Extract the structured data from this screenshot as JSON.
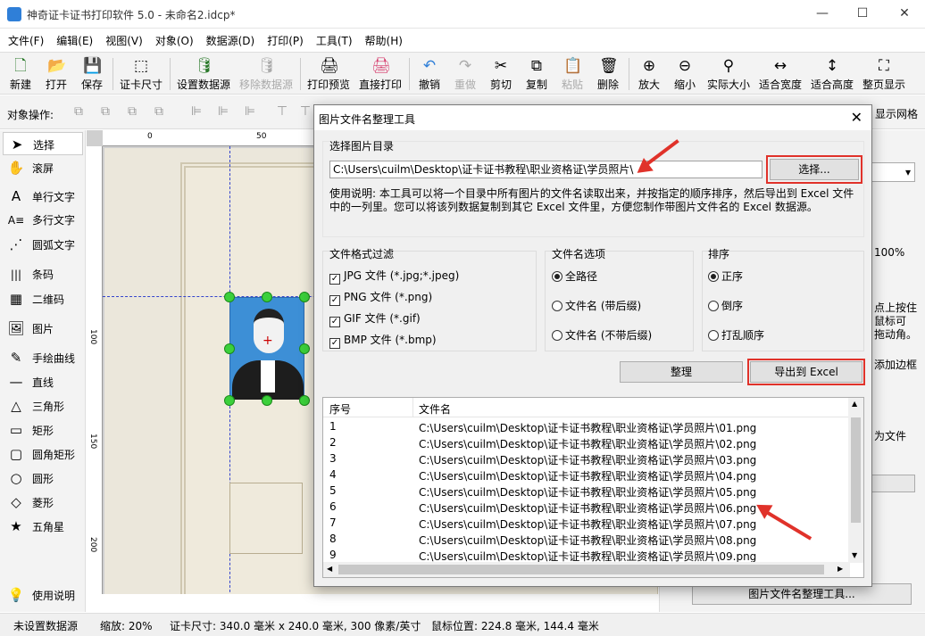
{
  "window": {
    "title": "神奇证卡证书打印软件 5.0 - 未命名2.idcp*",
    "min": "—",
    "max": "☐",
    "close": "✕"
  },
  "menu": [
    "文件(F)",
    "编辑(E)",
    "视图(V)",
    "对象(O)",
    "数据源(D)",
    "打印(P)",
    "工具(T)",
    "帮助(H)"
  ],
  "toolbar": [
    {
      "label": "新建",
      "icon": "🗋"
    },
    {
      "label": "打开",
      "icon": "📂"
    },
    {
      "label": "保存",
      "icon": "💾"
    },
    {
      "label": "证卡尺寸",
      "icon": "⬚"
    },
    {
      "label": "设置数据源",
      "icon": "🛢"
    },
    {
      "label": "移除数据源",
      "icon": "🛢"
    },
    {
      "label": "打印预览",
      "icon": "🖨"
    },
    {
      "label": "直接打印",
      "icon": "🖨"
    },
    {
      "label": "撤销",
      "icon": "↶"
    },
    {
      "label": "重做",
      "icon": "↷"
    },
    {
      "label": "剪切",
      "icon": "✂"
    },
    {
      "label": "复制",
      "icon": "⧉"
    },
    {
      "label": "粘贴",
      "icon": "📋"
    },
    {
      "label": "删除",
      "icon": "🗑"
    },
    {
      "label": "放大",
      "icon": "⊕"
    },
    {
      "label": "缩小",
      "icon": "⊖"
    },
    {
      "label": "实际大小",
      "icon": "⚲"
    },
    {
      "label": "适合宽度",
      "icon": "↔"
    },
    {
      "label": "适合高度",
      "icon": "↕"
    },
    {
      "label": "整页显示",
      "icon": "⛶"
    }
  ],
  "objbar": {
    "label": "对象操作:",
    "grid": "显示网格"
  },
  "tools": [
    {
      "label": "选择",
      "icon": "➤"
    },
    {
      "label": "滚屏",
      "icon": "✋"
    },
    {
      "label": "单行文字",
      "icon": "A"
    },
    {
      "label": "多行文字",
      "icon": "A≡"
    },
    {
      "label": "圆弧文字",
      "icon": "⋰"
    },
    {
      "label": "条码",
      "icon": "|||"
    },
    {
      "label": "二维码",
      "icon": "▦"
    },
    {
      "label": "图片",
      "icon": "🖼"
    },
    {
      "label": "手绘曲线",
      "icon": "✎"
    },
    {
      "label": "直线",
      "icon": "—"
    },
    {
      "label": "三角形",
      "icon": "△"
    },
    {
      "label": "矩形",
      "icon": "▭"
    },
    {
      "label": "圆角矩形",
      "icon": "▢"
    },
    {
      "label": "圆形",
      "icon": "○"
    },
    {
      "label": "菱形",
      "icon": "◇"
    },
    {
      "label": "五角星",
      "icon": "★"
    },
    {
      "label": "使用说明",
      "icon": "💡"
    }
  ],
  "ruler": {
    "top": [
      "0",
      "50"
    ],
    "left": [
      "100",
      "150",
      "200"
    ]
  },
  "rightpanel": {
    "pct": "100%",
    "t1": "点上按住",
    "t2": "鼠标可",
    "t3": "拖动角。",
    "t4": "添加边框",
    "t5": "为文件",
    "button": "图片文件名整理工具..."
  },
  "status": {
    "ds": "未设置数据源",
    "zoom": "缩放: 20%",
    "size": "证卡尺寸: 340.0 毫米 x 240.0 毫米, 300 像素/英寸",
    "mouse": "鼠标位置: 224.8 毫米, 144.4 毫米"
  },
  "dialog": {
    "title": "图片文件名整理工具",
    "close": "✕",
    "dir_label": "选择图片目录",
    "dir_value": "C:\\Users\\cuilm\\Desktop\\证卡证书教程\\职业资格证\\学员照片\\",
    "choose": "选择...",
    "hint": "使用说明: 本工具可以将一个目录中所有图片的文件名读取出来，并按指定的顺序排序，然后导出到 Excel 文件中的一列里。您可以将该列数据复制到其它 Excel 文件里，方便您制作带图片文件名的 Excel 数据源。",
    "filter_label": "文件格式过滤",
    "filters": [
      "JPG 文件 (*.jpg;*.jpeg)",
      "PNG 文件 (*.png)",
      "GIF 文件 (*.gif)",
      "BMP 文件 (*.bmp)"
    ],
    "name_label": "文件名选项",
    "names": [
      "全路径",
      "文件名 (带后缀)",
      "文件名 (不带后缀)"
    ],
    "sort_label": "排序",
    "sorts": [
      "正序",
      "倒序",
      "打乱顺序"
    ],
    "organize": "整理",
    "export": "导出到 Excel",
    "col_index": "序号",
    "col_name": "文件名",
    "rows": [
      {
        "i": "1",
        "f": "C:\\Users\\cuilm\\Desktop\\证卡证书教程\\职业资格证\\学员照片\\01.png"
      },
      {
        "i": "2",
        "f": "C:\\Users\\cuilm\\Desktop\\证卡证书教程\\职业资格证\\学员照片\\02.png"
      },
      {
        "i": "3",
        "f": "C:\\Users\\cuilm\\Desktop\\证卡证书教程\\职业资格证\\学员照片\\03.png"
      },
      {
        "i": "4",
        "f": "C:\\Users\\cuilm\\Desktop\\证卡证书教程\\职业资格证\\学员照片\\04.png"
      },
      {
        "i": "5",
        "f": "C:\\Users\\cuilm\\Desktop\\证卡证书教程\\职业资格证\\学员照片\\05.png"
      },
      {
        "i": "6",
        "f": "C:\\Users\\cuilm\\Desktop\\证卡证书教程\\职业资格证\\学员照片\\06.png"
      },
      {
        "i": "7",
        "f": "C:\\Users\\cuilm\\Desktop\\证卡证书教程\\职业资格证\\学员照片\\07.png"
      },
      {
        "i": "8",
        "f": "C:\\Users\\cuilm\\Desktop\\证卡证书教程\\职业资格证\\学员照片\\08.png"
      },
      {
        "i": "9",
        "f": "C:\\Users\\cuilm\\Desktop\\证卡证书教程\\职业资格证\\学员照片\\09.png"
      }
    ]
  }
}
